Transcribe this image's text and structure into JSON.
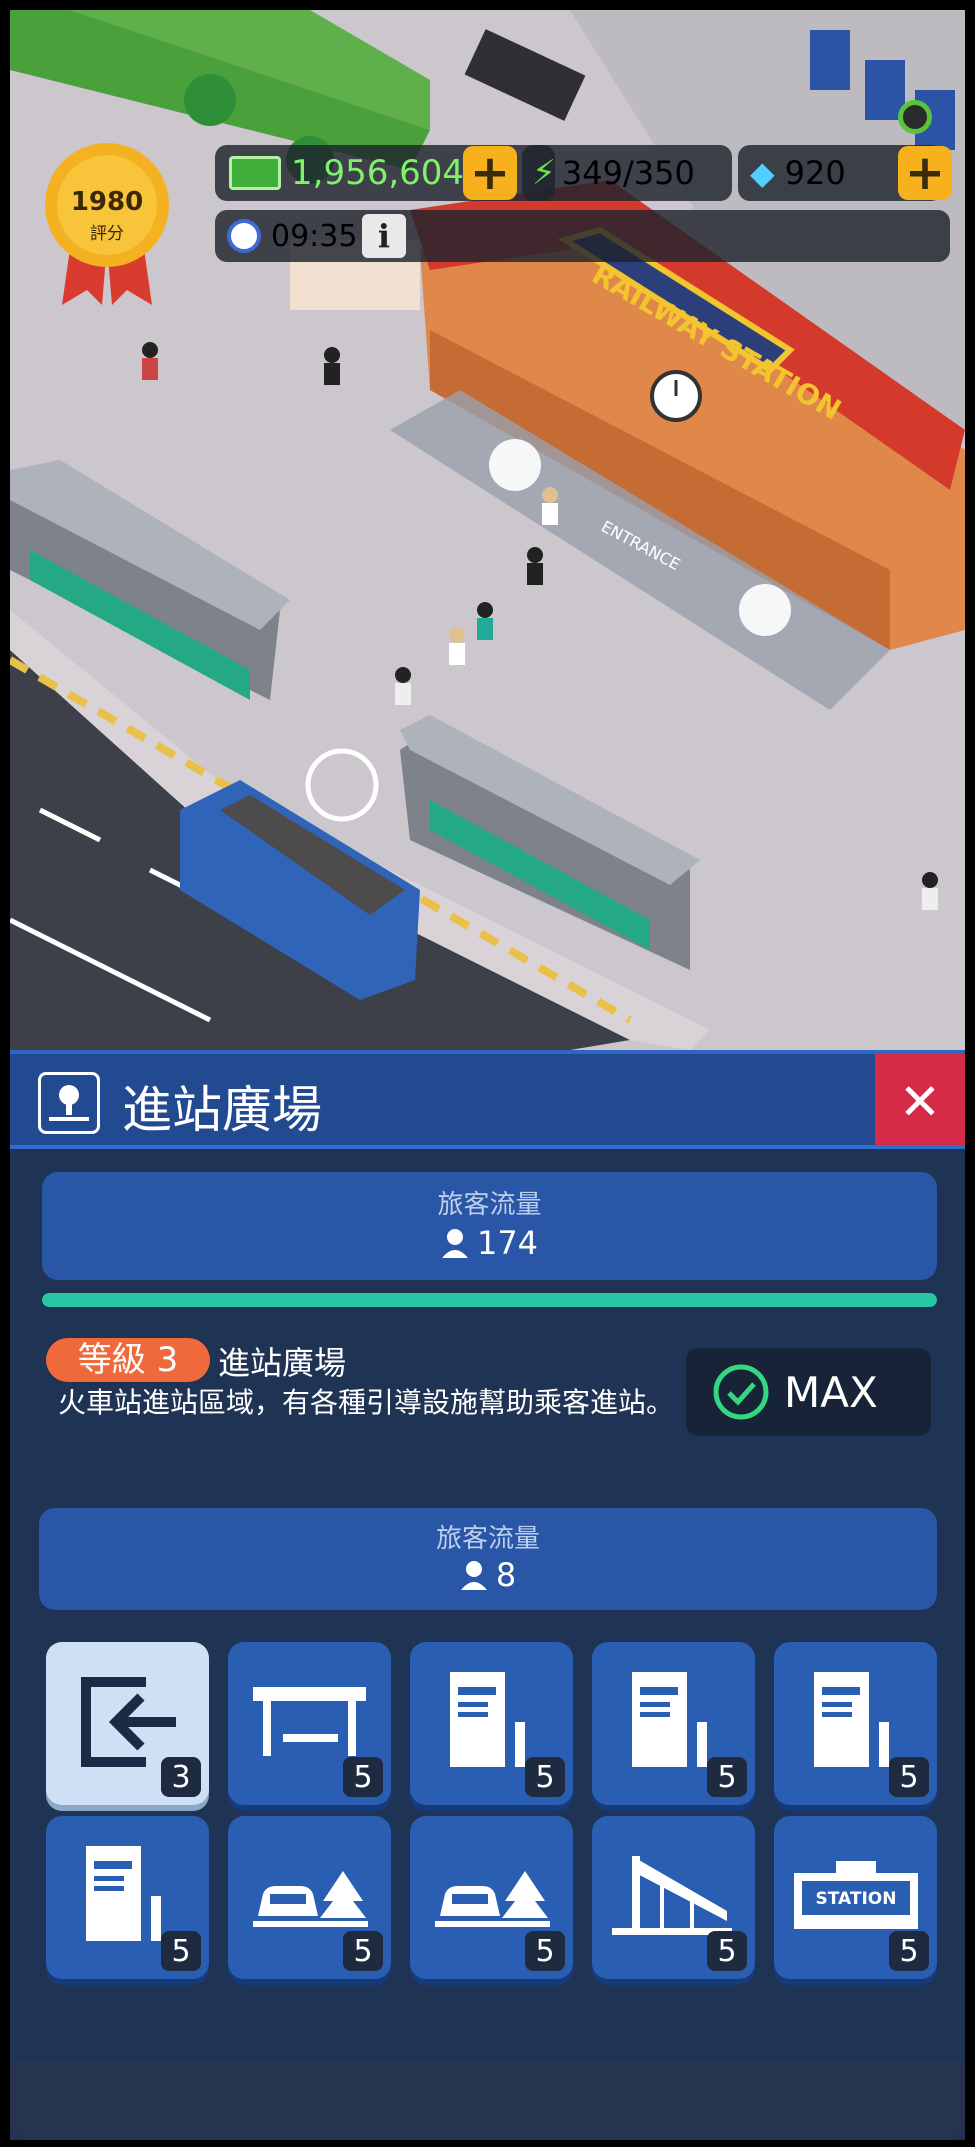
{
  "hud": {
    "rating_value": "1980",
    "rating_label": "評分",
    "cash": "1,956,604",
    "energy": "349/350",
    "gems": "920",
    "time": "09:35",
    "info_label": "i"
  },
  "scene": {
    "station_sign": "RAILWAY STATION",
    "entrance_label": "ENTRANCE"
  },
  "panel": {
    "title": "進站廣場",
    "close_label": "✕",
    "traffic_label": "旅客流量",
    "traffic_value": "174",
    "progress_fraction": 1.0,
    "level_badge": "等級 3",
    "facility_name": "進站廣場",
    "description": "火車站進站區域，有各種引導設施幫助乘客進站。",
    "max_label": "MAX",
    "sub_traffic_label": "旅客流量",
    "sub_traffic_value": "8"
  },
  "tiles": [
    {
      "icon": "entrance-arrow-icon",
      "level": "3",
      "selected": true
    },
    {
      "icon": "shelter-bench-icon",
      "level": "5",
      "selected": false
    },
    {
      "icon": "ticket-machine-icon",
      "level": "5",
      "selected": false
    },
    {
      "icon": "ticket-machine-icon",
      "level": "5",
      "selected": false
    },
    {
      "icon": "ticket-machine-icon",
      "level": "5",
      "selected": false
    },
    {
      "icon": "ticket-machine-icon",
      "level": "5",
      "selected": false
    },
    {
      "icon": "parking-car-tree-icon",
      "level": "5",
      "selected": false
    },
    {
      "icon": "parking-car-tree-icon",
      "level": "5",
      "selected": false
    },
    {
      "icon": "canopy-roof-icon",
      "level": "5",
      "selected": false
    },
    {
      "icon": "station-sign-icon",
      "level": "5",
      "selected": false
    }
  ],
  "colors": {
    "accent_green": "#29c8a5",
    "badge_orange": "#f0693a",
    "close_red": "#d62a49",
    "panel_blue": "#224a90",
    "tile_blue": "#2a5eb2"
  }
}
